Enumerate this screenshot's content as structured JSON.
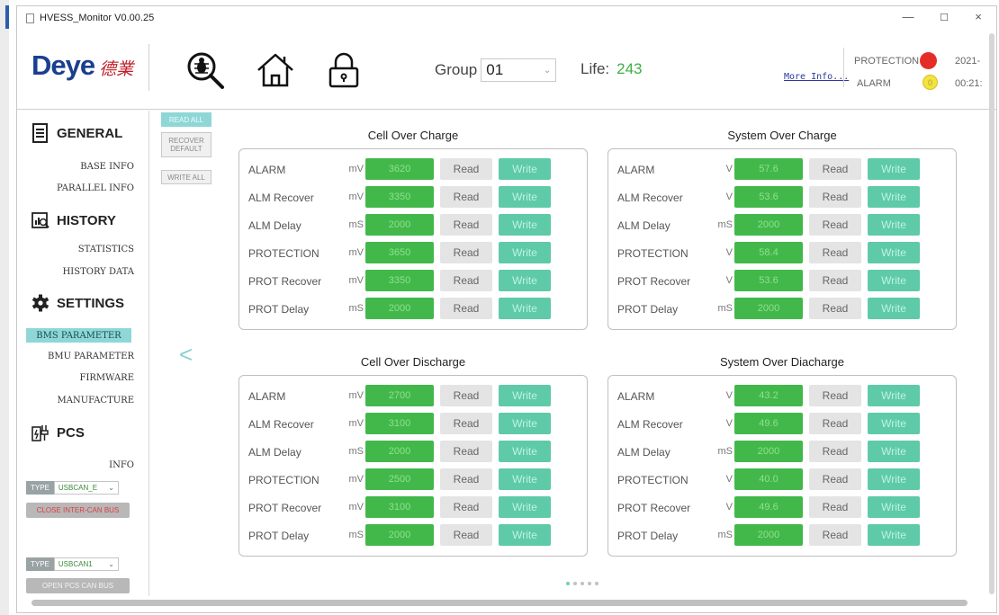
{
  "window": {
    "title": "HVESS_Monitor V0.00.25",
    "minimize": "—",
    "maximize": "☐",
    "close": "×"
  },
  "header": {
    "logo_text": "Deye",
    "logo_cn": "德業",
    "group_label": "Group",
    "group_value": "01",
    "life_label": "Life:",
    "life_value": "243",
    "more_info": "More Info...",
    "protection_label": "PROTECTION",
    "alarm_label": "ALARM",
    "alarm_led_text": "0",
    "date": "2021-",
    "time": "00:21:",
    "colors": {
      "protection_led": "#e52d27",
      "alarm_led": "#f2e342",
      "life": "#3cb043"
    },
    "icons": [
      "search-bug-icon",
      "home-icon",
      "lock-icon"
    ]
  },
  "sidebar": {
    "general": "GENERAL",
    "general_items": [
      "BASE INFO",
      "PARALLEL INFO"
    ],
    "history": "HISTORY",
    "history_items": [
      "STATISTICS",
      "HISTORY DATA"
    ],
    "settings": "SETTINGS",
    "settings_active": "BMS PARAMETER",
    "settings_items": [
      "BMU PARAMETER",
      "FIRMWARE",
      "MANUFACTURE"
    ],
    "pcs": "PCS",
    "pcs_items": [
      "INFO"
    ],
    "type1_tag": "TYPE",
    "type1_value": "USBCAN_E",
    "close_can": "CLOSE INTER-CAN BUS",
    "type2_tag": "TYPE",
    "type2_value": "USBCAN1",
    "open_pcs": "OPEN PCS CAN BUS"
  },
  "actions": {
    "read_all": "READ ALL",
    "recover_default": "RECOVER DEFAULT",
    "write_all": "WRITE ALL"
  },
  "buttons": {
    "read": "Read",
    "write": "Write"
  },
  "panels": [
    {
      "title": "Cell Over Charge",
      "rows": [
        {
          "label": "ALARM",
          "unit": "mV",
          "value": "3620"
        },
        {
          "label": "ALM Recover",
          "unit": "mV",
          "value": "3350"
        },
        {
          "label": "ALM Delay",
          "unit": "mS",
          "value": "2000"
        },
        {
          "label": "PROTECTION",
          "unit": "mV",
          "value": "3650"
        },
        {
          "label": "PROT Recover",
          "unit": "mV",
          "value": "3350"
        },
        {
          "label": "PROT Delay",
          "unit": "mS",
          "value": "2000"
        }
      ]
    },
    {
      "title": "System Over Charge",
      "rows": [
        {
          "label": "ALARM",
          "unit": "V",
          "value": "57.6"
        },
        {
          "label": "ALM Recover",
          "unit": "V",
          "value": "53.6"
        },
        {
          "label": "ALM Delay",
          "unit": "mS",
          "value": "2000"
        },
        {
          "label": "PROTECTION",
          "unit": "V",
          "value": "58.4"
        },
        {
          "label": "PROT Recover",
          "unit": "V",
          "value": "53.6"
        },
        {
          "label": "PROT Delay",
          "unit": "mS",
          "value": "2000"
        }
      ]
    },
    {
      "title": "Cell Over Discharge",
      "rows": [
        {
          "label": "ALARM",
          "unit": "mV",
          "value": "2700"
        },
        {
          "label": "ALM Recover",
          "unit": "mV",
          "value": "3100"
        },
        {
          "label": "ALM Delay",
          "unit": "mS",
          "value": "2000"
        },
        {
          "label": "PROTECTION",
          "unit": "mV",
          "value": "2500"
        },
        {
          "label": "PROT Recover",
          "unit": "mV",
          "value": "3100"
        },
        {
          "label": "PROT Delay",
          "unit": "mS",
          "value": "2000"
        }
      ]
    },
    {
      "title": "System Over Diacharge",
      "rows": [
        {
          "label": "ALARM",
          "unit": "V",
          "value": "43.2"
        },
        {
          "label": "ALM Recover",
          "unit": "V",
          "value": "49.6"
        },
        {
          "label": "ALM Delay",
          "unit": "mS",
          "value": "2000"
        },
        {
          "label": "PROTECTION",
          "unit": "V",
          "value": "40.0"
        },
        {
          "label": "PROT Recover",
          "unit": "V",
          "value": "49.6"
        },
        {
          "label": "PROT Delay",
          "unit": "mS",
          "value": "2000"
        }
      ]
    }
  ],
  "pager": {
    "count": 5,
    "active": 0
  }
}
